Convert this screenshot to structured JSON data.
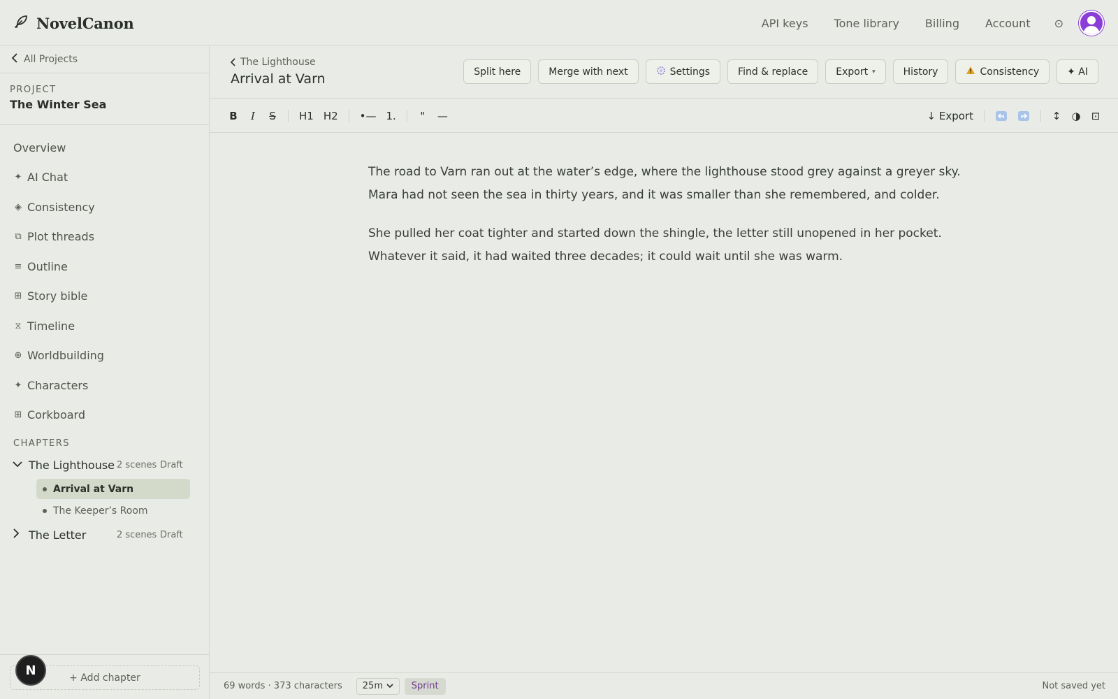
{
  "app": {
    "name": "NovelCanon"
  },
  "topnav": {
    "items": [
      "API keys",
      "Tone library",
      "Billing",
      "Account"
    ],
    "help_glyph": "⊙"
  },
  "sidebar": {
    "back_label": "All Projects",
    "project_label": "PROJECT",
    "project_name": "The Winter Sea",
    "nav": [
      {
        "icon": "",
        "label": "Overview"
      },
      {
        "icon": "✦",
        "label": "AI Chat"
      },
      {
        "icon": "◈",
        "label": "Consistency"
      },
      {
        "icon": "⧉",
        "label": "Plot threads"
      },
      {
        "icon": "≡",
        "label": "Outline"
      },
      {
        "icon": "⊞",
        "label": "Story bible"
      },
      {
        "icon": "⧖",
        "label": "Timeline"
      },
      {
        "icon": "⊕",
        "label": "Worldbuilding"
      },
      {
        "icon": "✦",
        "label": "Characters"
      },
      {
        "icon": "⊞",
        "label": "Corkboard"
      }
    ],
    "chapters_label": "CHAPTERS",
    "chapters": [
      {
        "title": "The Lighthouse",
        "scenes_count": "2 scenes",
        "status": "Draft",
        "expanded": true,
        "scenes": [
          {
            "title": "Arrival at Varn",
            "active": true
          },
          {
            "title": "The Keeper’s Room",
            "active": false
          }
        ]
      },
      {
        "title": "The Letter",
        "scenes_count": "2 scenes",
        "status": "Draft",
        "expanded": false,
        "scenes": []
      }
    ],
    "add_chapter": "+ Add chapter",
    "badge_letter": "N"
  },
  "scene": {
    "breadcrumb": "The Lighthouse",
    "title": "Arrival at Varn"
  },
  "actions": {
    "split": "Split here",
    "merge": "Merge with next",
    "settings": "Settings",
    "find_replace": "Find & replace",
    "export": "Export",
    "export_caret": "▾",
    "history": "History",
    "consistency": "Consistency",
    "ai": "✦ AI"
  },
  "toolbar": {
    "bold": "B",
    "italic": "I",
    "strike": "S",
    "h1": "H1",
    "h2": "H2",
    "bullet": "•—",
    "numbered": "1.",
    "quote": "\"",
    "rule": "—",
    "export": "↓ Export",
    "line_height": "↕",
    "contrast": "◑",
    "focus": "⊡"
  },
  "editor": {
    "paragraphs": [
      "The road to Varn ran out at the water’s edge, where the lighthouse stood grey against a greyer sky. Mara had not seen the sea in thirty years, and it was smaller than she remembered, and colder.",
      "She pulled her coat tighter and started down the shingle, the letter still unopened in her pocket. Whatever it said, it had waited three decades; it could wait until she was warm."
    ]
  },
  "status": {
    "word_count": "69 words · 373 characters",
    "timer": "25m",
    "sprint": "Sprint",
    "save_state": "Not saved yet"
  },
  "colors": {
    "background": "#e9ece6",
    "accent_purple": "#8b3dd8",
    "active_scene_bg": "#d4dac9",
    "sprint_text": "#6c3b8d",
    "warning": "#e0a020",
    "undo_blue": "#8fb5e0"
  }
}
